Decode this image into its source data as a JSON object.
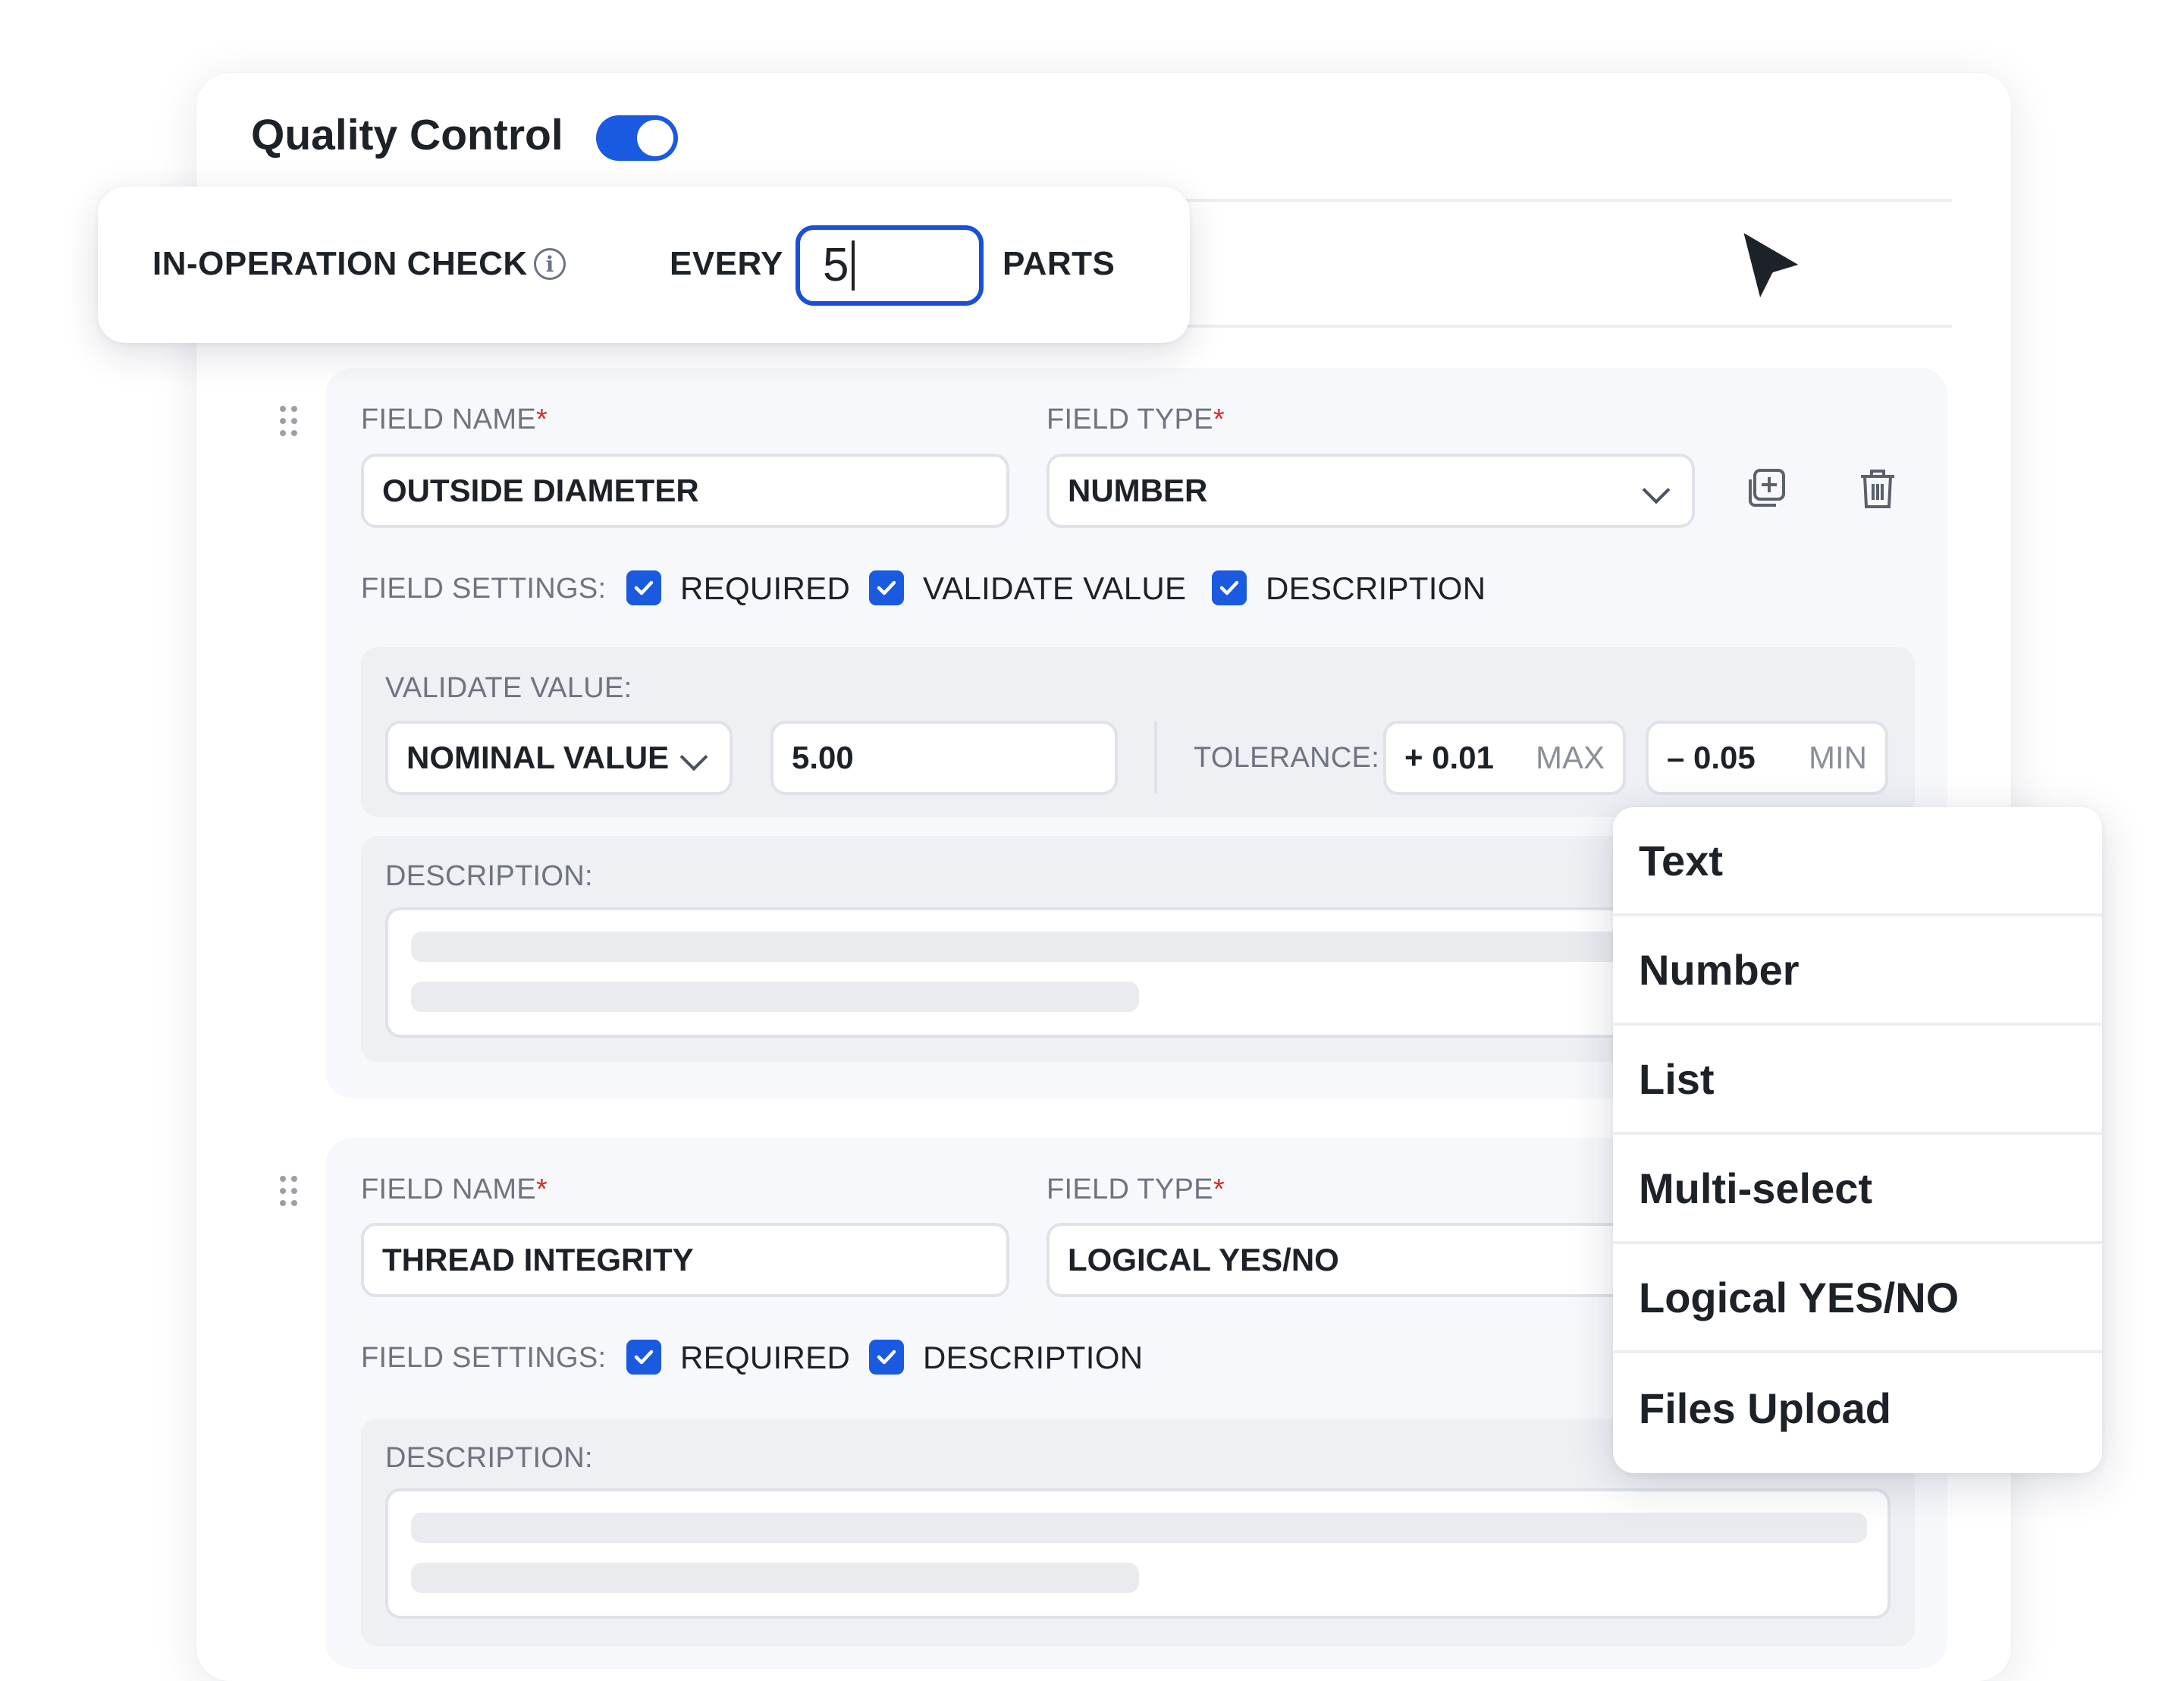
{
  "header": {
    "title": "Quality Control",
    "toggle_on": true
  },
  "check_popup": {
    "label": "IN-OPERATION CHECK",
    "every_label": "EVERY",
    "parts_value": "5",
    "parts_label": "PARTS"
  },
  "field1": {
    "name_label": "FIELD NAME",
    "name_value": "OUTSIDE DIAMETER",
    "type_label": "FIELD TYPE",
    "type_value": "NUMBER",
    "settings_label": "FIELD SETTINGS:",
    "settings": [
      "REQUIRED",
      "VALIDATE VALUE",
      "DESCRIPTION"
    ],
    "validate_label": "VALIDATE VALUE:",
    "validate_mode": "NOMINAL VALUE",
    "nominal_value": "5.00",
    "tolerance_label": "TOLERANCE:",
    "tol_max_value": "+ 0.01",
    "tol_max_label": "MAX",
    "tol_min_value": "– 0.05",
    "tol_min_label": "MIN",
    "description_label": "DESCRIPTION:"
  },
  "field2": {
    "name_label": "FIELD NAME",
    "name_value": "THREAD INTEGRITY",
    "type_label": "FIELD TYPE",
    "type_value": "LOGICAL YES/NO",
    "settings_label": "FIELD SETTINGS:",
    "settings": [
      "REQUIRED",
      "DESCRIPTION"
    ],
    "description_label": "DESCRIPTION:"
  },
  "required_mark": "*",
  "type_menu": {
    "options": [
      "Text",
      "Number",
      "List",
      "Multi-select",
      "Logical YES/NO",
      "Files Upload"
    ]
  },
  "icons": [
    "info-icon",
    "drag-handle-icon",
    "chevron-down-icon",
    "duplicate-icon",
    "trash-icon",
    "checkbox-checked-icon",
    "cursor-arrow-icon"
  ],
  "colors": {
    "accent": "#1a5ae0",
    "required": "#d92b2b"
  }
}
